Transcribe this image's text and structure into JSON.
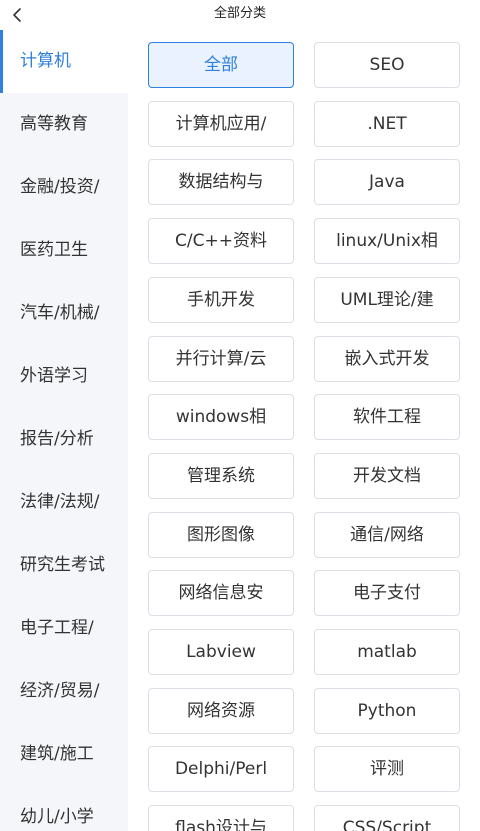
{
  "header": {
    "title": "全部分类",
    "back_icon": "chevron-left-icon"
  },
  "colors": {
    "accent": "#2f7fde",
    "active_bg": "#e9f2fe",
    "sidebar_bg": "#f4f6f9",
    "border": "#dcdfe5"
  },
  "sidebar": {
    "items": [
      {
        "label": "计算机",
        "active": true
      },
      {
        "label": "高等教育",
        "active": false
      },
      {
        "label": "金融/投资/",
        "active": false
      },
      {
        "label": "医药卫生",
        "active": false
      },
      {
        "label": "汽车/机械/",
        "active": false
      },
      {
        "label": "外语学习",
        "active": false
      },
      {
        "label": "报告/分析",
        "active": false
      },
      {
        "label": "法律/法规/",
        "active": false
      },
      {
        "label": "研究生考试",
        "active": false
      },
      {
        "label": "电子工程/",
        "active": false
      },
      {
        "label": "经济/贸易/",
        "active": false
      },
      {
        "label": "建筑/施工",
        "active": false
      },
      {
        "label": "幼儿/小学",
        "active": false
      }
    ]
  },
  "categories": [
    {
      "label": "全部",
      "active": true
    },
    {
      "label": "SEO",
      "active": false
    },
    {
      "label": "计算机应用/",
      "active": false
    },
    {
      "label": ".NET",
      "active": false
    },
    {
      "label": "数据结构与",
      "active": false
    },
    {
      "label": "Java",
      "active": false
    },
    {
      "label": "C/C++资料",
      "active": false
    },
    {
      "label": "linux/Unix相",
      "active": false
    },
    {
      "label": "手机开发",
      "active": false
    },
    {
      "label": "UML理论/建",
      "active": false
    },
    {
      "label": "并行计算/云",
      "active": false
    },
    {
      "label": "嵌入式开发",
      "active": false
    },
    {
      "label": "windows相",
      "active": false
    },
    {
      "label": "软件工程",
      "active": false
    },
    {
      "label": "管理系统",
      "active": false
    },
    {
      "label": "开发文档",
      "active": false
    },
    {
      "label": "图形图像",
      "active": false
    },
    {
      "label": "通信/网络",
      "active": false
    },
    {
      "label": "网络信息安",
      "active": false
    },
    {
      "label": "电子支付",
      "active": false
    },
    {
      "label": "Labview",
      "active": false
    },
    {
      "label": "matlab",
      "active": false
    },
    {
      "label": "网络资源",
      "active": false
    },
    {
      "label": "Python",
      "active": false
    },
    {
      "label": "Delphi/Perl",
      "active": false
    },
    {
      "label": "评测",
      "active": false
    },
    {
      "label": "flash设计与",
      "active": false
    },
    {
      "label": "CSS/Script",
      "active": false
    }
  ]
}
